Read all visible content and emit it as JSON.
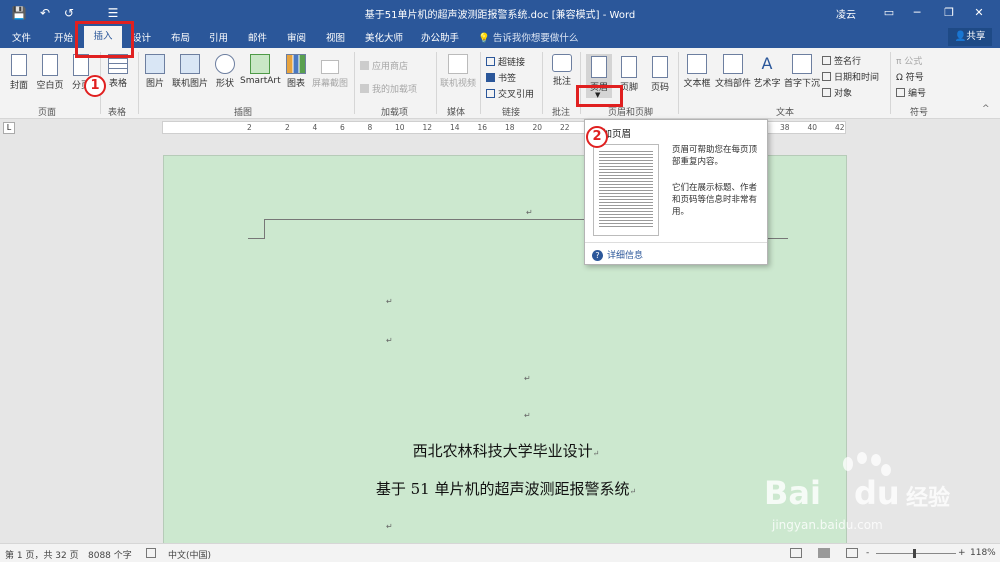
{
  "window": {
    "title": "基于51单片机的超声波测距报警系统.doc [兼容模式] - Word",
    "user": "凌云",
    "controls": {
      "restore": "▭",
      "minimize": "─",
      "maximize": "❐",
      "close": "✕"
    }
  },
  "quick_access": {
    "save": "💾",
    "undo": "↶",
    "redo": "↺",
    "list": "☰"
  },
  "tabs": [
    "文件",
    "开始",
    "插入",
    "设计",
    "布局",
    "引用",
    "邮件",
    "审阅",
    "视图",
    "美化大师",
    "办公助手"
  ],
  "active_tab": "插入",
  "tell_me": "告诉我你想要做什么",
  "share": "共享",
  "ribbon": {
    "groups": {
      "pages": "页面",
      "tables": "表格",
      "illustrations": "插图",
      "addins": "加载项",
      "media": "媒体",
      "links": "链接",
      "comments": "批注",
      "header_footer": "页眉和页脚",
      "text": "文本",
      "symbols": "符号"
    },
    "buttons": {
      "cover": "封面",
      "blank": "空白页",
      "page_break": "分页",
      "table": "表格",
      "picture": "图片",
      "online_picture": "联机图片",
      "shapes": "形状",
      "smartart": "SmartArt",
      "chart": "图表",
      "screenshot": "屏幕截图",
      "store": "应用商店",
      "my_addins": "我的加载项",
      "online_video": "联机视频",
      "hyperlink": "超链接",
      "bookmark": "书签",
      "cross_ref": "交叉引用",
      "comment": "批注",
      "header": "页眉",
      "footer": "页脚",
      "page_number": "页码",
      "textbox": "文本框",
      "quick_parts": "文档部件",
      "wordart": "艺术字",
      "dropcap": "首字下沉",
      "signature": "签名行",
      "datetime": "日期和时间",
      "object": "对象",
      "equation": "公式",
      "symbol": "符号",
      "number": "编号"
    }
  },
  "ruler": {
    "numbers": [
      "2",
      "2",
      "4",
      "6",
      "8",
      "10",
      "12",
      "14",
      "16",
      "18",
      "20",
      "22",
      "24",
      "26",
      "28",
      "30",
      "32",
      "34",
      "36",
      "38",
      "40",
      "42"
    ],
    "corner": "L"
  },
  "dropdown": {
    "title": "添加页眉",
    "desc1": "页眉可帮助您在每页顶部重复内容。",
    "desc2": "它们在展示标题、作者和页码等信息时非常有用。",
    "more_info": "详细信息"
  },
  "document": {
    "line1": "西北农林科技大学毕业设计",
    "line2": "基于 51 单片机的超声波测距报警系统",
    "para_mark": "↵"
  },
  "annotations": {
    "step1": "1",
    "step2": "2",
    "color": "#e02020"
  },
  "status": {
    "page": "第 1 页，共 32 页",
    "words": "8088 个字",
    "language": "中文(中国)",
    "zoom": "118%",
    "minus": "-",
    "plus": "+"
  },
  "watermark": {
    "brand": "Bai",
    "brand2": "du",
    "site": "jingyan.baidu.com",
    "label": "经验"
  },
  "colors": {
    "word_blue": "#2b579a",
    "page_green": "#cce8cf",
    "ribbon_bg": "#f3f3f3"
  }
}
